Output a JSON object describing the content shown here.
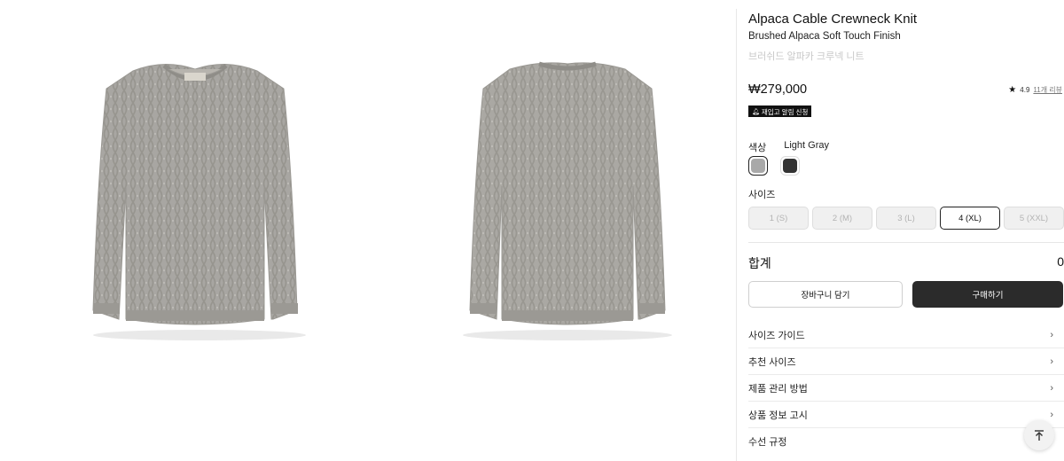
{
  "product": {
    "title": "Alpaca Cable Crewneck Knit",
    "subtitle": "Brushed Alpaca Soft Touch Finish",
    "name_kr": "브러쉬드 알파카 크루넥 니트",
    "price": "₩279,000",
    "rating": "4.9",
    "reviews": "11개 리뷰",
    "restock_badge": "재입고 알림 신청"
  },
  "options": {
    "color_label": "색상",
    "selected_color": "Light Gray",
    "colors": [
      {
        "name": "light-gray",
        "hex": "#a9a9a9"
      },
      {
        "name": "charcoal",
        "hex": "#333333"
      }
    ],
    "size_label": "사이즈",
    "sizes": [
      "1 (S)",
      "2 (M)",
      "3 (L)",
      "4 (XL)",
      "5 (XXL)"
    ],
    "selected_size": "4 (XL)"
  },
  "total": {
    "label": "합계",
    "value": "0"
  },
  "actions": {
    "cart": "장바구니 담기",
    "buy": "구매하기"
  },
  "accordion": [
    "사이즈 가이드",
    "추천 사이즈",
    "제품 관리 방법",
    "상품 정보 고시",
    "수선 규정"
  ],
  "icons": {
    "star": "star-icon",
    "bell": "bell-icon",
    "chevron": "chevron-right-icon",
    "scroll_top": "arrow-up-to-top-icon"
  }
}
